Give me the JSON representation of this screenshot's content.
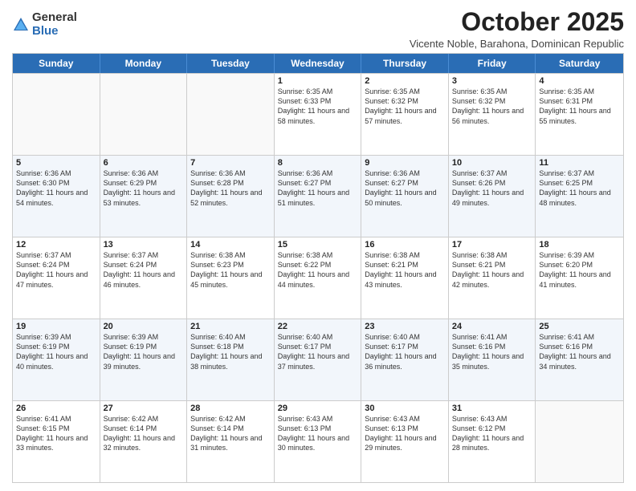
{
  "logo": {
    "general": "General",
    "blue": "Blue"
  },
  "header": {
    "month": "October 2025",
    "location": "Vicente Noble, Barahona, Dominican Republic"
  },
  "weekdays": [
    "Sunday",
    "Monday",
    "Tuesday",
    "Wednesday",
    "Thursday",
    "Friday",
    "Saturday"
  ],
  "rows": [
    [
      {
        "day": "",
        "sunrise": "",
        "sunset": "",
        "daylight": ""
      },
      {
        "day": "",
        "sunrise": "",
        "sunset": "",
        "daylight": ""
      },
      {
        "day": "",
        "sunrise": "",
        "sunset": "",
        "daylight": ""
      },
      {
        "day": "1",
        "sunrise": "Sunrise: 6:35 AM",
        "sunset": "Sunset: 6:33 PM",
        "daylight": "Daylight: 11 hours and 58 minutes."
      },
      {
        "day": "2",
        "sunrise": "Sunrise: 6:35 AM",
        "sunset": "Sunset: 6:32 PM",
        "daylight": "Daylight: 11 hours and 57 minutes."
      },
      {
        "day": "3",
        "sunrise": "Sunrise: 6:35 AM",
        "sunset": "Sunset: 6:32 PM",
        "daylight": "Daylight: 11 hours and 56 minutes."
      },
      {
        "day": "4",
        "sunrise": "Sunrise: 6:35 AM",
        "sunset": "Sunset: 6:31 PM",
        "daylight": "Daylight: 11 hours and 55 minutes."
      }
    ],
    [
      {
        "day": "5",
        "sunrise": "Sunrise: 6:36 AM",
        "sunset": "Sunset: 6:30 PM",
        "daylight": "Daylight: 11 hours and 54 minutes."
      },
      {
        "day": "6",
        "sunrise": "Sunrise: 6:36 AM",
        "sunset": "Sunset: 6:29 PM",
        "daylight": "Daylight: 11 hours and 53 minutes."
      },
      {
        "day": "7",
        "sunrise": "Sunrise: 6:36 AM",
        "sunset": "Sunset: 6:28 PM",
        "daylight": "Daylight: 11 hours and 52 minutes."
      },
      {
        "day": "8",
        "sunrise": "Sunrise: 6:36 AM",
        "sunset": "Sunset: 6:27 PM",
        "daylight": "Daylight: 11 hours and 51 minutes."
      },
      {
        "day": "9",
        "sunrise": "Sunrise: 6:36 AM",
        "sunset": "Sunset: 6:27 PM",
        "daylight": "Daylight: 11 hours and 50 minutes."
      },
      {
        "day": "10",
        "sunrise": "Sunrise: 6:37 AM",
        "sunset": "Sunset: 6:26 PM",
        "daylight": "Daylight: 11 hours and 49 minutes."
      },
      {
        "day": "11",
        "sunrise": "Sunrise: 6:37 AM",
        "sunset": "Sunset: 6:25 PM",
        "daylight": "Daylight: 11 hours and 48 minutes."
      }
    ],
    [
      {
        "day": "12",
        "sunrise": "Sunrise: 6:37 AM",
        "sunset": "Sunset: 6:24 PM",
        "daylight": "Daylight: 11 hours and 47 minutes."
      },
      {
        "day": "13",
        "sunrise": "Sunrise: 6:37 AM",
        "sunset": "Sunset: 6:24 PM",
        "daylight": "Daylight: 11 hours and 46 minutes."
      },
      {
        "day": "14",
        "sunrise": "Sunrise: 6:38 AM",
        "sunset": "Sunset: 6:23 PM",
        "daylight": "Daylight: 11 hours and 45 minutes."
      },
      {
        "day": "15",
        "sunrise": "Sunrise: 6:38 AM",
        "sunset": "Sunset: 6:22 PM",
        "daylight": "Daylight: 11 hours and 44 minutes."
      },
      {
        "day": "16",
        "sunrise": "Sunrise: 6:38 AM",
        "sunset": "Sunset: 6:21 PM",
        "daylight": "Daylight: 11 hours and 43 minutes."
      },
      {
        "day": "17",
        "sunrise": "Sunrise: 6:38 AM",
        "sunset": "Sunset: 6:21 PM",
        "daylight": "Daylight: 11 hours and 42 minutes."
      },
      {
        "day": "18",
        "sunrise": "Sunrise: 6:39 AM",
        "sunset": "Sunset: 6:20 PM",
        "daylight": "Daylight: 11 hours and 41 minutes."
      }
    ],
    [
      {
        "day": "19",
        "sunrise": "Sunrise: 6:39 AM",
        "sunset": "Sunset: 6:19 PM",
        "daylight": "Daylight: 11 hours and 40 minutes."
      },
      {
        "day": "20",
        "sunrise": "Sunrise: 6:39 AM",
        "sunset": "Sunset: 6:19 PM",
        "daylight": "Daylight: 11 hours and 39 minutes."
      },
      {
        "day": "21",
        "sunrise": "Sunrise: 6:40 AM",
        "sunset": "Sunset: 6:18 PM",
        "daylight": "Daylight: 11 hours and 38 minutes."
      },
      {
        "day": "22",
        "sunrise": "Sunrise: 6:40 AM",
        "sunset": "Sunset: 6:17 PM",
        "daylight": "Daylight: 11 hours and 37 minutes."
      },
      {
        "day": "23",
        "sunrise": "Sunrise: 6:40 AM",
        "sunset": "Sunset: 6:17 PM",
        "daylight": "Daylight: 11 hours and 36 minutes."
      },
      {
        "day": "24",
        "sunrise": "Sunrise: 6:41 AM",
        "sunset": "Sunset: 6:16 PM",
        "daylight": "Daylight: 11 hours and 35 minutes."
      },
      {
        "day": "25",
        "sunrise": "Sunrise: 6:41 AM",
        "sunset": "Sunset: 6:16 PM",
        "daylight": "Daylight: 11 hours and 34 minutes."
      }
    ],
    [
      {
        "day": "26",
        "sunrise": "Sunrise: 6:41 AM",
        "sunset": "Sunset: 6:15 PM",
        "daylight": "Daylight: 11 hours and 33 minutes."
      },
      {
        "day": "27",
        "sunrise": "Sunrise: 6:42 AM",
        "sunset": "Sunset: 6:14 PM",
        "daylight": "Daylight: 11 hours and 32 minutes."
      },
      {
        "day": "28",
        "sunrise": "Sunrise: 6:42 AM",
        "sunset": "Sunset: 6:14 PM",
        "daylight": "Daylight: 11 hours and 31 minutes."
      },
      {
        "day": "29",
        "sunrise": "Sunrise: 6:43 AM",
        "sunset": "Sunset: 6:13 PM",
        "daylight": "Daylight: 11 hours and 30 minutes."
      },
      {
        "day": "30",
        "sunrise": "Sunrise: 6:43 AM",
        "sunset": "Sunset: 6:13 PM",
        "daylight": "Daylight: 11 hours and 29 minutes."
      },
      {
        "day": "31",
        "sunrise": "Sunrise: 6:43 AM",
        "sunset": "Sunset: 6:12 PM",
        "daylight": "Daylight: 11 hours and 28 minutes."
      },
      {
        "day": "",
        "sunrise": "",
        "sunset": "",
        "daylight": ""
      }
    ]
  ]
}
